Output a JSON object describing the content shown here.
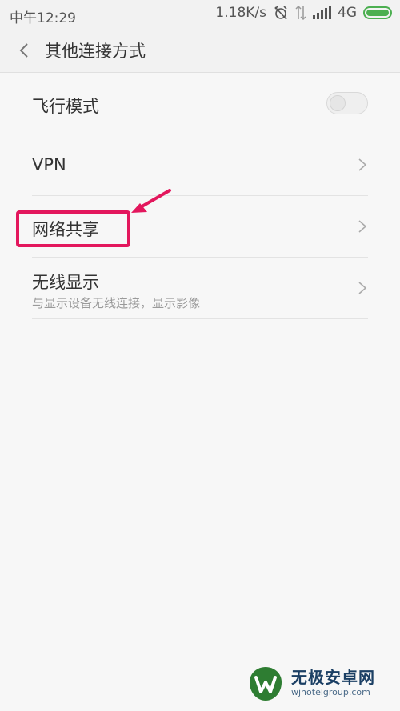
{
  "status_bar": {
    "time": "中午12:29",
    "network_speed": "1.18K/s",
    "network_type": "4G",
    "icons": [
      "alarm-off-icon",
      "data-arrows-icon",
      "signal-icon",
      "battery-icon"
    ]
  },
  "header": {
    "title": "其他连接方式",
    "back_icon": "chevron-left-icon"
  },
  "items": [
    {
      "label": "飞行模式",
      "control": "toggle",
      "toggle_on": false
    },
    {
      "label": "VPN",
      "control": "chevron"
    },
    {
      "label": "网络共享",
      "control": "chevron",
      "highlighted": true
    },
    {
      "label": "无线显示",
      "subtitle": "与显示设备无线连接，显示影像",
      "control": "chevron"
    }
  ],
  "annotation": {
    "color": "#e3175d"
  },
  "watermark": {
    "brand": "无极安卓网",
    "url": "wjhotelgroup.com"
  },
  "colors": {
    "accent": "#4caf50",
    "highlight": "#e3175d",
    "background": "#f7f7f7"
  }
}
